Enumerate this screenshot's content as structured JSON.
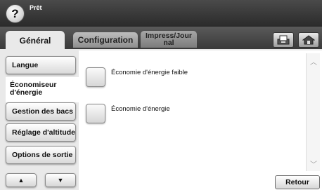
{
  "status": {
    "help_symbol": "?",
    "text": "Prêt"
  },
  "tabs": [
    {
      "label": "Général",
      "active": true
    },
    {
      "label": "Configuration",
      "active": false
    },
    {
      "label": "Impress/Journal",
      "active": false
    }
  ],
  "header_icons": [
    "tray-icon",
    "home-icon"
  ],
  "nav": {
    "items": [
      {
        "label": "Langue",
        "selected": false
      },
      {
        "label": "Économiseur d'énergie",
        "selected": true
      },
      {
        "label": "Gestion des bacs",
        "selected": false
      },
      {
        "label": "Réglage d'altitude",
        "selected": false
      },
      {
        "label": "Options de sortie",
        "selected": false
      }
    ],
    "up_symbol": "▲",
    "down_symbol": "▼"
  },
  "options": [
    {
      "label": "Économie d'énergie faible"
    },
    {
      "label": "Économie d'énergie"
    }
  ],
  "scroll": {
    "up_symbol": "︿",
    "down_symbol": "﹀"
  },
  "footer": {
    "back_label": "Retour"
  }
}
